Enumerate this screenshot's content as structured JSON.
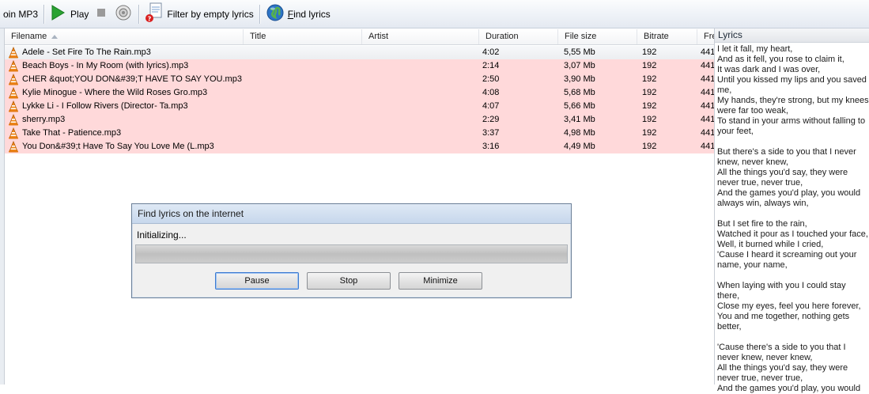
{
  "toolbar": {
    "join_label": "oin MP3",
    "play_label": "Play",
    "filter_label": "Filter by empty lyrics",
    "find_label_first": "F",
    "find_label_rest": "ind lyrics",
    "icons": [
      "join-icon",
      "play-icon",
      "stop-icon",
      "speaker-icon",
      "filter-icon",
      "globe-icon"
    ]
  },
  "table": {
    "columns": [
      "Filename",
      "Title",
      "Artist",
      "Duration",
      "File size",
      "Bitrate",
      "Fre"
    ],
    "rows": [
      {
        "filename": "Adele - Set Fire To The Rain.mp3",
        "duration": "4:02",
        "size": "5,55 Mb",
        "bitrate": "192",
        "freq": "441",
        "style": "sel"
      },
      {
        "filename": "Beach Boys - In My Room (with lyrics).mp3",
        "duration": "2:14",
        "size": "3,07 Mb",
        "bitrate": "192",
        "freq": "441",
        "style": "err"
      },
      {
        "filename": "CHER &quot;YOU DON&#39;T HAVE TO SAY YOU.mp3",
        "duration": "2:50",
        "size": "3,90 Mb",
        "bitrate": "192",
        "freq": "441",
        "style": "err"
      },
      {
        "filename": "Kylie Minogue - Where the Wild Roses Gro.mp3",
        "duration": "4:08",
        "size": "5,68 Mb",
        "bitrate": "192",
        "freq": "441",
        "style": "err"
      },
      {
        "filename": "Lykke Li - I Follow Rivers (Director- Ta.mp3",
        "duration": "4:07",
        "size": "5,66 Mb",
        "bitrate": "192",
        "freq": "441",
        "style": "err"
      },
      {
        "filename": "sherry.mp3",
        "duration": "2:29",
        "size": "3,41 Mb",
        "bitrate": "192",
        "freq": "441",
        "style": "err"
      },
      {
        "filename": "Take That - Patience.mp3",
        "duration": "3:37",
        "size": "4,98 Mb",
        "bitrate": "192",
        "freq": "441",
        "style": "err"
      },
      {
        "filename": "You Don&#39;t Have To Say You Love Me (L.mp3",
        "duration": "3:16",
        "size": "4,49 Mb",
        "bitrate": "192",
        "freq": "441",
        "style": "err"
      }
    ]
  },
  "lyrics": {
    "header": "Lyrics",
    "text": "I let it fall, my heart,\nAnd as it fell, you rose to claim it,\nIt was dark and I was over,\nUntil you kissed my lips and you saved me,\nMy hands, they're strong, but my knees were far too weak,\nTo stand in your arms without falling to your feet,\n\nBut there's a side to you that I never knew, never knew,\nAll the things you'd say, they were never true, never true,\nAnd the games you'd play, you would always win, always win,\n\nBut I set fire to the rain,\nWatched it pour as I touched your face,\nWell, it burned while I cried,\n'Cause I heard it screaming out your name, your name,\n\nWhen laying with you I could stay there,\nClose my eyes, feel you here forever,\nYou and me together, nothing gets better,\n\n'Cause there's a side to you that I never knew, never knew,\nAll the things you'd say, they were never true, never true,\nAnd the games you'd play, you would"
  },
  "dialog": {
    "title": "Find lyrics on the internet",
    "status": "Initializing...",
    "pause_label": "Pause",
    "stop_label": "Stop",
    "minimize_label": "Minimize"
  },
  "colors": {
    "error_row": "#ffd9da",
    "selected_row": "#eceef1",
    "accent": "#3d7bd1"
  }
}
